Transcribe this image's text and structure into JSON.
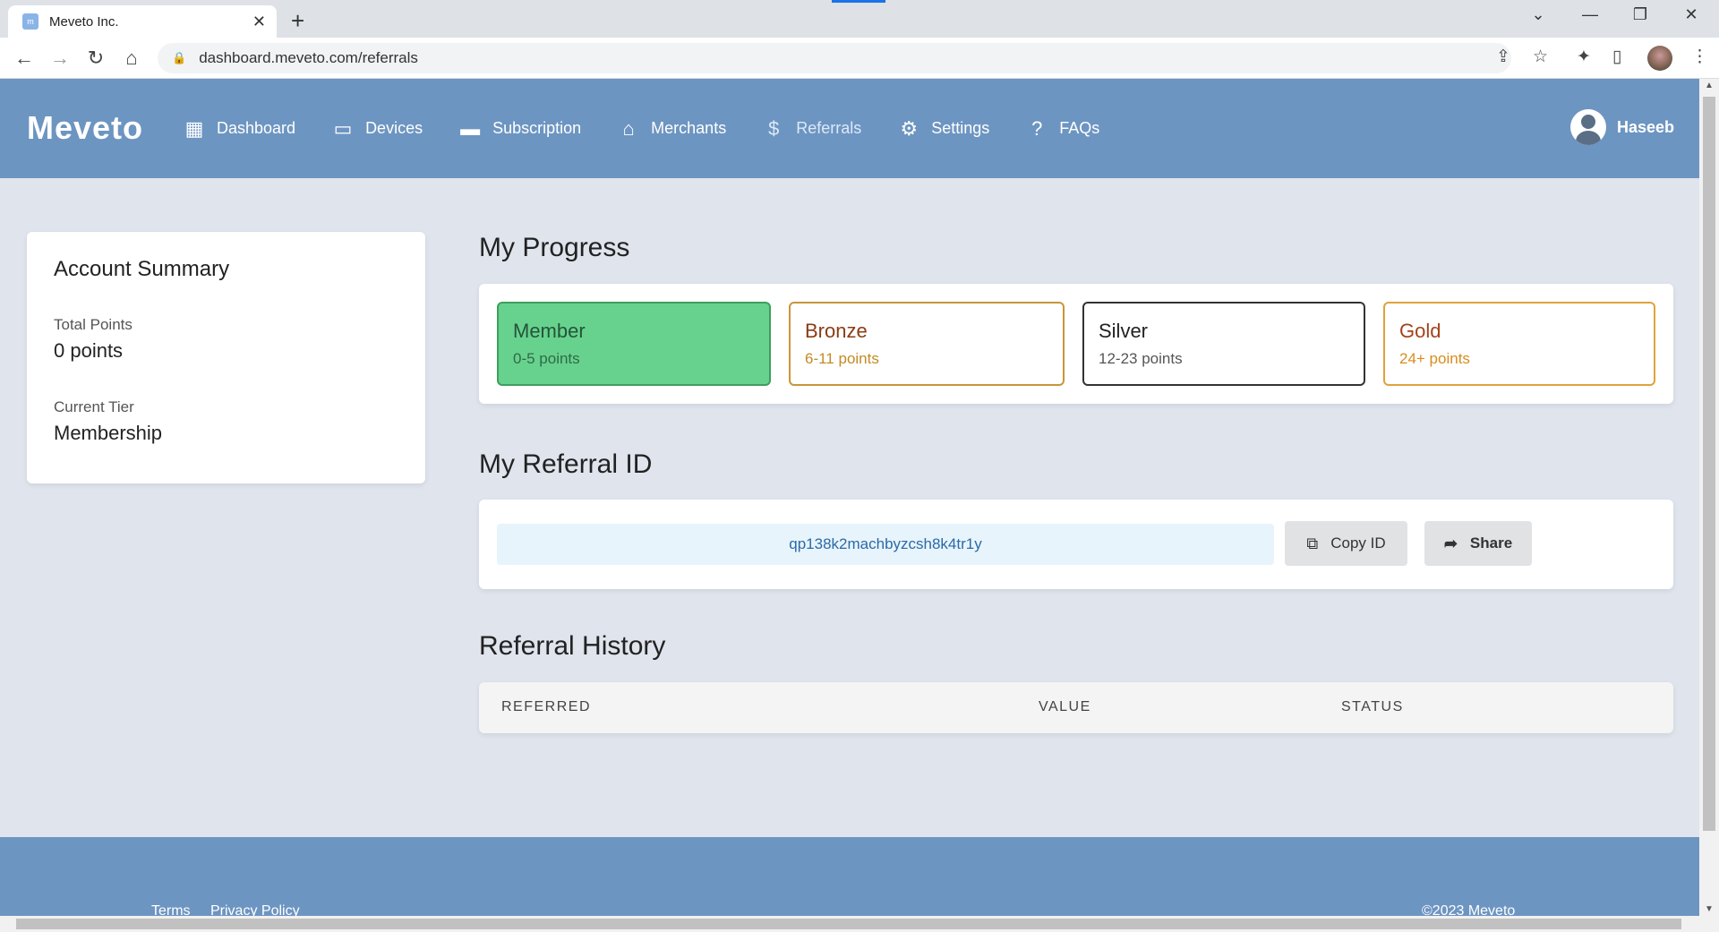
{
  "browser": {
    "tab_title": "Meveto Inc.",
    "tab_favicon": "m",
    "url": "dashboard.meveto.com/referrals"
  },
  "app": {
    "brand": "Meveto",
    "nav": [
      {
        "label": "Dashboard",
        "icon": "dashboard-icon"
      },
      {
        "label": "Devices",
        "icon": "devices-icon"
      },
      {
        "label": "Subscription",
        "icon": "credit-card-icon"
      },
      {
        "label": "Merchants",
        "icon": "store-icon"
      },
      {
        "label": "Referrals",
        "icon": "dollar-icon",
        "active": true
      },
      {
        "label": "Settings",
        "icon": "gear-icon"
      },
      {
        "label": "FAQs",
        "icon": "question-icon"
      }
    ],
    "user_name": "Haseeb"
  },
  "summary": {
    "title": "Account Summary",
    "total_points_label": "Total Points",
    "total_points_value": "0 points",
    "current_tier_label": "Current Tier",
    "current_tier_value": "Membership"
  },
  "progress": {
    "title": "My Progress",
    "tiers": [
      {
        "name": "Member",
        "range": "0-5 points"
      },
      {
        "name": "Bronze",
        "range": "6-11 points"
      },
      {
        "name": "Silver",
        "range": "12-23 points"
      },
      {
        "name": "Gold",
        "range": "24+ points"
      }
    ]
  },
  "referral": {
    "title": "My Referral ID",
    "id": "qp138k2machbyzcsh8k4tr1y",
    "copy_label": "Copy ID",
    "share_label": "Share"
  },
  "history": {
    "title": "Referral History",
    "columns": [
      "REFERRED",
      "VALUE",
      "STATUS"
    ]
  },
  "footer": {
    "terms": "Terms",
    "privacy": "Privacy Policy",
    "copyright": "©2023 Meveto"
  },
  "colors": {
    "header": "#6d95c1",
    "background": "#dfe4ed",
    "member": "#67d28d"
  }
}
